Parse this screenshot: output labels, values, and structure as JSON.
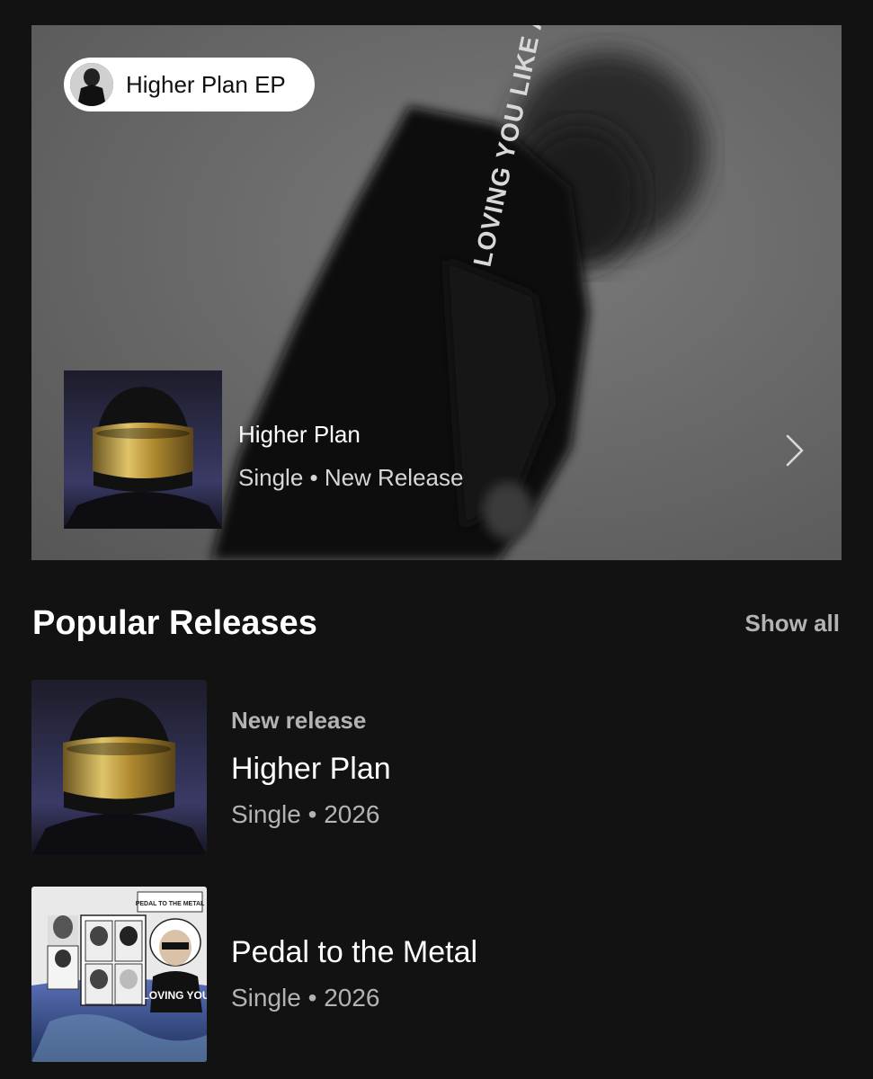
{
  "hero": {
    "pill_label": "Higher Plan EP",
    "title": "Higher Plan",
    "subtitle": "Single • New Release",
    "hoodie_text": "LOVING YOU LIKE A SONG"
  },
  "section": {
    "title": "Popular Releases",
    "show_all": "Show all"
  },
  "releases": [
    {
      "eyebrow": "New release",
      "title": "Higher Plan",
      "meta": "Single • 2026"
    },
    {
      "title": "Pedal to the Metal",
      "meta": "Single • 2026",
      "cover_text": "PEDAL TO THE METAL",
      "cover_text2": "LOVING YOU"
    }
  ],
  "colors": {
    "background": "#121212",
    "muted": "#b3b3b3",
    "gold": "#c9a84a"
  }
}
